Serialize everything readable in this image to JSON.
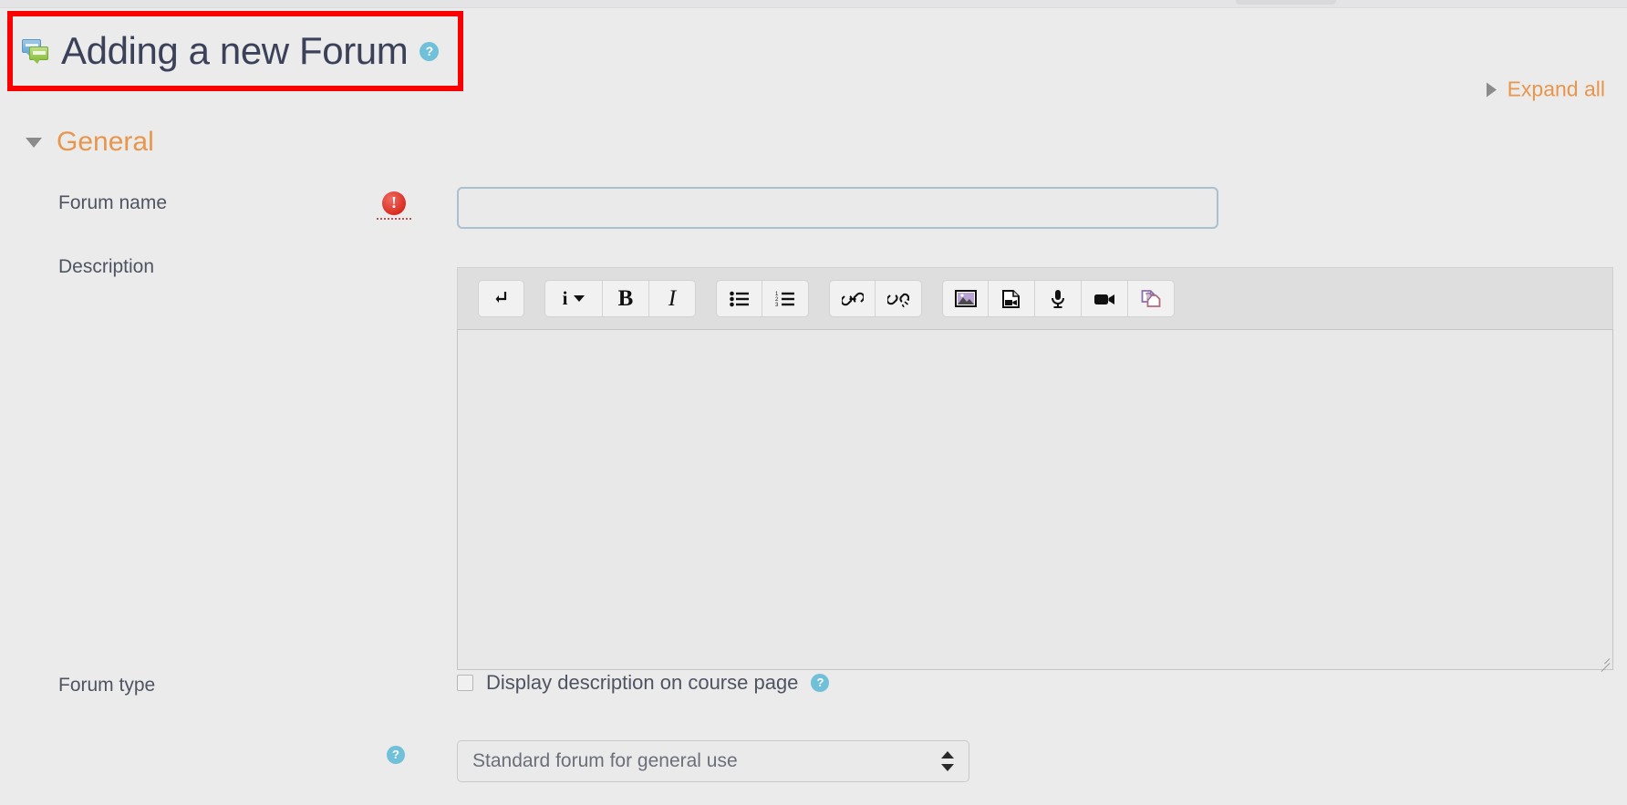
{
  "header": {
    "title": "Adding a new Forum",
    "icon_name": "forum-icon",
    "help_glyph": "?"
  },
  "toolbar_links": {
    "expand_all": "Expand all"
  },
  "sections": {
    "general": {
      "title": "General"
    }
  },
  "fields": {
    "forum_name": {
      "label": "Forum name",
      "value": "",
      "placeholder": "",
      "required_glyph": "!"
    },
    "description": {
      "label": "Description",
      "value": ""
    },
    "display_description": {
      "label": "Display description on course page",
      "checked": false,
      "help_glyph": "?"
    },
    "forum_type": {
      "label": "Forum type",
      "value": "Standard forum for general use",
      "help_glyph": "?"
    }
  },
  "editor": {
    "buttons": [
      {
        "name": "line-break-icon",
        "glyph": "⤵"
      },
      {
        "name": "paragraph-style-icon",
        "glyph": "i"
      },
      {
        "name": "bold-icon",
        "glyph": "B"
      },
      {
        "name": "italic-icon",
        "glyph": "I"
      },
      {
        "name": "bulleted-list-icon",
        "glyph": "☰"
      },
      {
        "name": "numbered-list-icon",
        "glyph": "☰"
      },
      {
        "name": "link-icon",
        "glyph": "ὑ7"
      },
      {
        "name": "unlink-icon",
        "glyph": "ὑ7"
      },
      {
        "name": "insert-image-icon",
        "glyph": "ὛC"
      },
      {
        "name": "insert-media-icon",
        "glyph": "Ὄ4"
      },
      {
        "name": "record-audio-icon",
        "glyph": "Ἲ4"
      },
      {
        "name": "record-video-icon",
        "glyph": "὏9"
      },
      {
        "name": "manage-files-icon",
        "glyph": "Ὅ1"
      }
    ]
  },
  "colors": {
    "accent_orange": "#e8964c",
    "title_navy": "#3b4159",
    "help_blue": "#6fc0d8",
    "required_red": "#d82c20",
    "annotation_red": "#fb0000",
    "page_bg": "#ebebeb"
  }
}
